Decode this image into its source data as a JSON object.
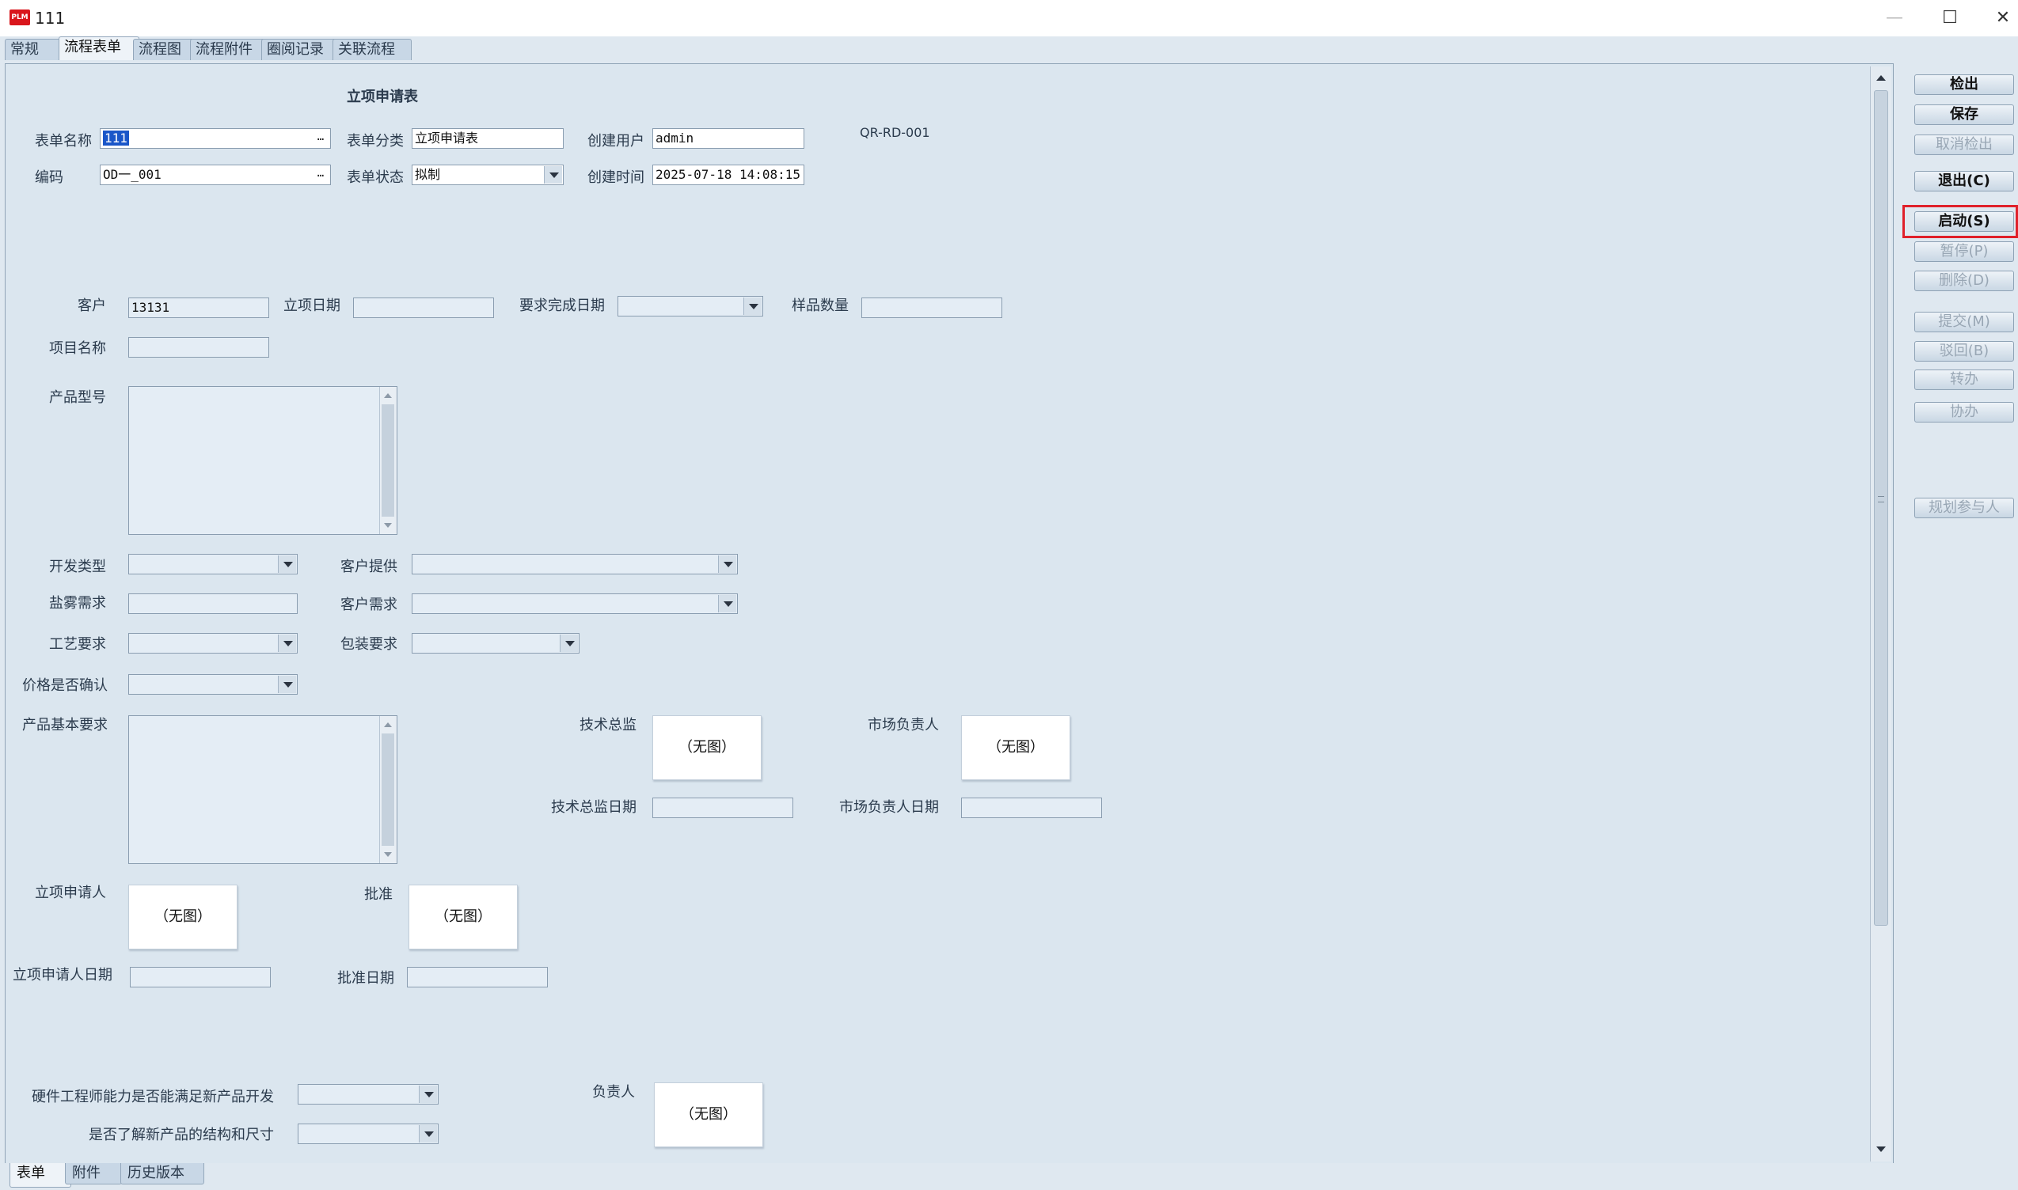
{
  "window": {
    "title": "111",
    "logo": "PLM",
    "minimize": "—",
    "maximize": "☐",
    "close": "✕"
  },
  "tabs": [
    "常规",
    "流程表单",
    "流程图",
    "流程附件",
    "圈阅记录",
    "关联流程"
  ],
  "form": {
    "heading": "立项申请表",
    "doc_code": "QR-RD-001",
    "form_name_label": "表单名称",
    "form_name_value": "111",
    "category_label": "表单分类",
    "category_value": "立项申请表",
    "creator_label": "创建用户",
    "creator_value": "admin",
    "code_label": "编码",
    "code_value": "OD一_001",
    "status_label": "表单状态",
    "status_value": "拟制",
    "created_time_label": "创建时间",
    "created_time_value": "2025-07-18 14:08:15",
    "customer_label": "客户",
    "customer_value": "13131",
    "project_date_label": "立项日期",
    "required_date_label": "要求完成日期",
    "sample_qty_label": "样品数量",
    "project_name_label": "项目名称",
    "product_model_label": "产品型号",
    "dev_type_label": "开发类型",
    "customer_supply_label": "客户提供",
    "salt_spray_label": "盐雾需求",
    "customer_demand_label": "客户需求",
    "process_req_label": "工艺要求",
    "packaging_req_label": "包装要求",
    "price_confirmed_label": "价格是否确认",
    "basic_req_label": "产品基本要求",
    "tech_director_label": "技术总监",
    "tech_director_img": "（无图）",
    "market_lead_label": "市场负责人",
    "market_lead_img": "（无图）",
    "tech_director_date_label": "技术总监日期",
    "market_lead_date_label": "市场负责人日期",
    "applicant_label": "立项申请人",
    "applicant_img": "（无图）",
    "approve_label": "批准",
    "approve_img": "（无图）",
    "applicant_date_label": "立项申请人日期",
    "approve_date_label": "批准日期",
    "hw_capability_label": "硬件工程师能力是否能满足新产品开发",
    "structure_known_label": "是否了解新产品的结构和尺寸",
    "owner_label": "负责人",
    "owner_img": "（无图）"
  },
  "actions": {
    "checkout": "检出",
    "save": "保存",
    "cancel_checkout": "取消检出",
    "exit": "退出(C)",
    "start": "启动(S)",
    "pause": "暂停(P)",
    "delete": "删除(D)",
    "submit": "提交(M)",
    "reject": "驳回(B)",
    "transfer": "转办",
    "assist": "协办",
    "plan_participants": "规划参与人"
  },
  "bottom_tabs": [
    "表单",
    "附件",
    "历史版本"
  ]
}
